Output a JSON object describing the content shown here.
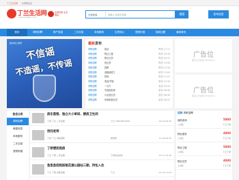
{
  "topbar": {
    "left_text": "丁兰生活网",
    "right_text": "[切换站点]"
  },
  "header": {
    "logo_text": "丁兰生活网",
    "logo_sub": "www.dinglan.com",
    "badge_text": "全国百强 生活网站",
    "search": {
      "category": "分类信息",
      "placeholder": "请输入关键字搜索",
      "button": "搜索"
    },
    "post_button": "发布信息"
  },
  "nav": {
    "items": [
      "首页",
      "求职招聘",
      "房产信息",
      "二手交易",
      "本地服务",
      "生意转让",
      "宠物乐园",
      "招商加盟",
      "商家黄页"
    ],
    "active": 0
  },
  "banner": {
    "line1": "不信谣",
    "line2": "不造谣，不传谣",
    "org": "杭州市公安局"
  },
  "panel": {
    "title_pre": "最新",
    "title_post": "发布",
    "rows": [
      {
        "cat": "求职招聘",
        "title": "保洁",
        "time": "昨天 17:17"
      },
      {
        "cat": "求职招聘",
        "title": "物业工程",
        "time": "昨天 16:16"
      },
      {
        "cat": "求职招聘",
        "title": "物业文员",
        "time": "昨天 16:12"
      },
      {
        "cat": "求职招聘",
        "title": "营业员",
        "time": "昨天 15:56"
      },
      {
        "cat": "求职招聘",
        "title": "招聘",
        "time": "昨天 15:16"
      },
      {
        "cat": "求职招聘",
        "title": "道路维修工",
        "time": "前天 13:05"
      },
      {
        "cat": "求职招聘",
        "title": "厨师",
        "time": "前天 11:01"
      },
      {
        "cat": "求职招聘",
        "title": "收盆/学徒",
        "time": "前天 10:10"
      },
      {
        "cat": "求职招聘",
        "title": "一元干",
        "time": "前天 09:10"
      },
      {
        "cat": "求职招聘",
        "title": "中西面包师",
        "time": "前天 08:56"
      },
      {
        "cat": "求职招聘",
        "title": "小店营业员",
        "time": "前天 08:40"
      },
      {
        "cat": "求职招聘",
        "title": "驾驶部营业员",
        "time": "前天 08:22"
      }
    ]
  },
  "ads": [
    {
      "main": "广告位",
      "sub": "首页上方右侧 (84x49px)"
    },
    {
      "main": "广告位",
      "sub": "首页上方右侧 (84x49px)"
    }
  ],
  "sidebar": {
    "head": "信息分类",
    "items": [
      "求职招聘",
      "房屋信息",
      "本地服务",
      "二手交易",
      "宠物狗猫"
    ],
    "active": 0
  },
  "feed": [
    {
      "title": "房东直租、独立大小单间、厨房卫生间",
      "meta": "丁桥 丁兰 二手出租",
      "user": "丁兰 18876653366",
      "date": "04-22 09:35"
    },
    {
      "title": "找托老师",
      "meta": "丁桥 丁兰 求职招聘",
      "user": "杨老师",
      "date": "11-09 09:35"
    },
    {
      "title": "丁桥便民租房",
      "meta": "丁兰 丁桥 二手出租",
      "user": "丁桥住房合约",
      "date": "07-17 15:16"
    },
    {
      "title": "急急急招租前桃花源公园站三期，持包入住",
      "meta": "丁兰 丁桥 房屋出租",
      "user": "丁兰",
      "date": "07-14 11:02"
    }
  ],
  "recruit": {
    "head_pre": "招聘",
    "head_post": "求职招聘",
    "items": [
      {
        "title": "佣托老师",
        "salary": "5000",
        "loc": "上城区",
        "tag": "丁兰丁桥"
      },
      {
        "title": "物业保安",
        "salary": "4000",
        "loc": "上城区",
        "tag": "丁兰丁桥"
      },
      {
        "title": "物业工程",
        "salary": "5000",
        "loc": "上城区",
        "tag": "丁兰丁桥"
      },
      {
        "title": "物业文员",
        "salary": "4000",
        "loc": "上城区",
        "tag": "丁兰丁桥"
      }
    ]
  }
}
